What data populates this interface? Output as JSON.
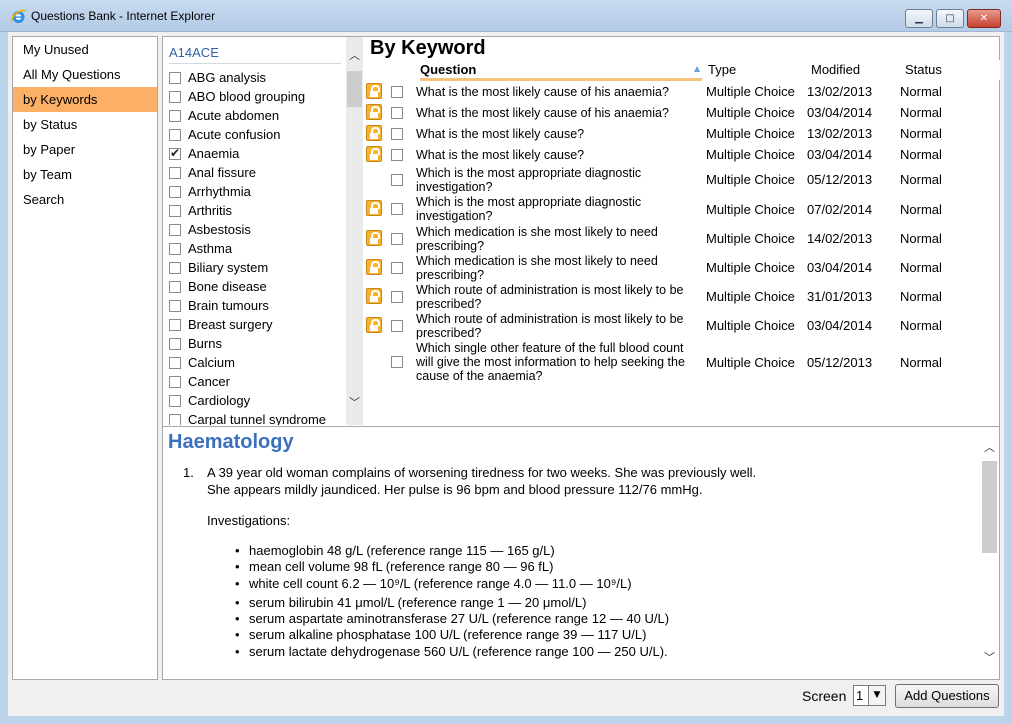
{
  "window": {
    "title": "Questions Bank - Internet Explorer"
  },
  "nav": [
    "My Unused",
    "All My Questions",
    "by Keywords",
    "by Status",
    "by Paper",
    "by Team",
    "Search"
  ],
  "keywords": {
    "group": "A14ACE",
    "items": [
      {
        "label": "ABG analysis",
        "checked": false
      },
      {
        "label": "ABO blood grouping",
        "checked": false
      },
      {
        "label": "Acute abdomen",
        "checked": false
      },
      {
        "label": "Acute confusion",
        "checked": false
      },
      {
        "label": "Anaemia",
        "checked": true
      },
      {
        "label": "Anal fissure",
        "checked": false
      },
      {
        "label": "Arrhythmia",
        "checked": false
      },
      {
        "label": "Arthritis",
        "checked": false
      },
      {
        "label": "Asbestosis",
        "checked": false
      },
      {
        "label": "Asthma",
        "checked": false
      },
      {
        "label": "Biliary system",
        "checked": false
      },
      {
        "label": "Bone disease",
        "checked": false
      },
      {
        "label": "Brain tumours",
        "checked": false
      },
      {
        "label": "Breast surgery",
        "checked": false
      },
      {
        "label": "Burns",
        "checked": false
      },
      {
        "label": "Calcium",
        "checked": false
      },
      {
        "label": "Cancer",
        "checked": false
      },
      {
        "label": "Cardiology",
        "checked": false
      },
      {
        "label": "Carpal tunnel syndrome",
        "checked": false
      }
    ]
  },
  "questions": {
    "title": "By Keyword",
    "columns": {
      "question": "Question",
      "type": "Type",
      "modified": "Modified",
      "status": "Status"
    },
    "rows": [
      {
        "locked": true,
        "text": "What is the most likely cause of his anaemia?",
        "type": "Multiple Choice",
        "modified": "13/02/2013",
        "status": "Normal"
      },
      {
        "locked": true,
        "text": "What is the most likely cause of his anaemia?",
        "type": "Multiple Choice",
        "modified": "03/04/2014",
        "status": "Normal"
      },
      {
        "locked": true,
        "text": "What is the most likely cause?",
        "type": "Multiple Choice",
        "modified": "13/02/2013",
        "status": "Normal"
      },
      {
        "locked": true,
        "text": "What is the most likely cause?",
        "type": "Multiple Choice",
        "modified": "03/04/2014",
        "status": "Normal"
      },
      {
        "locked": false,
        "text": "Which is the most appropriate diagnostic investigation?",
        "type": "Multiple Choice",
        "modified": "05/12/2013",
        "status": "Normal"
      },
      {
        "locked": true,
        "text": "Which is the most appropriate diagnostic investigation?",
        "type": "Multiple Choice",
        "modified": "07/02/2014",
        "status": "Normal"
      },
      {
        "locked": true,
        "text": "Which medication is she most likely to need prescribing?",
        "type": "Multiple Choice",
        "modified": "14/02/2013",
        "status": "Normal"
      },
      {
        "locked": true,
        "text": "Which medication is she most likely to need prescribing?",
        "type": "Multiple Choice",
        "modified": "03/04/2014",
        "status": "Normal"
      },
      {
        "locked": true,
        "text": "Which route of administration is most likely to be prescribed?",
        "type": "Multiple Choice",
        "modified": "31/01/2013",
        "status": "Normal"
      },
      {
        "locked": true,
        "text": "Which route of administration is most likely to be prescribed?",
        "type": "Multiple Choice",
        "modified": "03/04/2014",
        "status": "Normal"
      },
      {
        "locked": false,
        "text": "Which single other feature of the full blood count will give the most information to help seeking the cause of the anaemia?",
        "type": "Multiple Choice",
        "modified": "05/12/2013",
        "status": "Normal"
      }
    ]
  },
  "detail": {
    "title": "Haematology",
    "number": "1.",
    "stem_line1": "A 39 year old woman complains of worsening tiredness for two weeks. She was previously well.",
    "stem_line2": "She appears mildly jaundiced. Her pulse is 96 bpm and blood pressure 112/76 mmHg.",
    "investigations_label": "Investigations:",
    "bullets": [
      "haemoglobin 48 g/L (reference range 115 — 165 g/L)",
      "mean cell volume 98 fL (reference range 80 — 96 fL)",
      "white cell count 6.2 — 10⁹/L (reference range 4.0 — 11.0 — 10⁹/L)",
      "serum bilirubin 41 μmol/L (reference range 1 — 20 μmol/L)",
      "serum aspartate aminotransferase 27 U/L (reference range 12 — 40 U/L)",
      "serum alkaline phosphatase 100 U/L (reference range 39 — 117 U/L)",
      "serum lactate dehydrogenase 560 U/L (reference range 100 — 250 U/L)."
    ]
  },
  "footer": {
    "screen_label": "Screen",
    "screen_value": "1",
    "add_button": "Add Questions"
  },
  "colors": {
    "nav_active": "#fbb066",
    "title_blue": "#3b6fbf",
    "lock_gold": "#f8b32c"
  }
}
